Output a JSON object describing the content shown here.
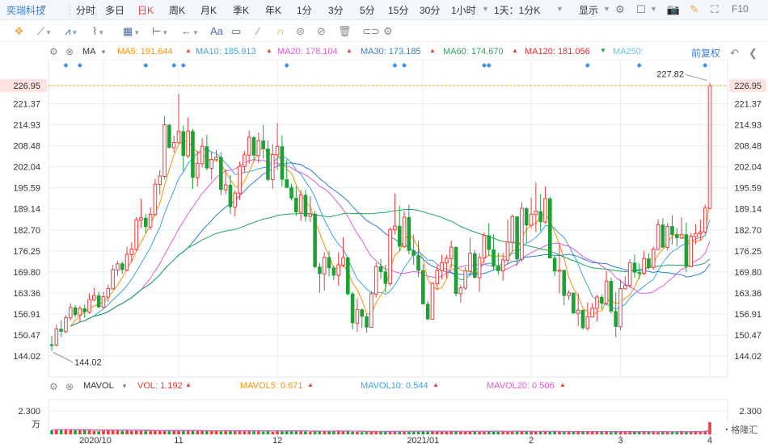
{
  "topbar": {
    "stock_name": "奕瑞科技",
    "periods": [
      "分时",
      "多日",
      "日K",
      "周K",
      "月K",
      "季K",
      "年K",
      "1分",
      "3分",
      "5分",
      "15分",
      "30分",
      "1小时",
      "1天：1分K"
    ],
    "active_period": "日K",
    "display_label": "显示",
    "f10_label": "F10"
  },
  "toolbar": {
    "text_tool": "Aa"
  },
  "ma_legend": {
    "label": "MA",
    "items": [
      {
        "text": "MA5: 191.644",
        "color": "#ff8f00"
      },
      {
        "text": "MA10: 185.913",
        "color": "#3aa3e3"
      },
      {
        "text": "MA20: 178.104",
        "color": "#e05ad6"
      },
      {
        "text": "MA30: 173.185",
        "color": "#2d7fd4"
      },
      {
        "text": "MA60: 174.670",
        "color": "#22a85b"
      },
      {
        "text": "MA120: 181.056",
        "color": "#e0312f"
      },
      {
        "text": "MA250:",
        "color": "#59c7e8"
      }
    ],
    "adjust_label": "前复权"
  },
  "vol_legend": {
    "label": "MAVOL",
    "items": [
      {
        "text": "VOL: 1.192",
        "color": "#ef3b3b"
      },
      {
        "text": "MAVOL5: 0.671",
        "color": "#ff8f00"
      },
      {
        "text": "MAVOL10: 0.544",
        "color": "#3aa3e3"
      },
      {
        "text": "MAVOL20: 0.506",
        "color": "#e05ad6"
      }
    ]
  },
  "colors": {
    "up": "#ef3b3b",
    "down": "#1aa334",
    "grid": "#e6edf7",
    "axis_text": "#333333",
    "price_line": "#f5a623"
  },
  "chart_data": [
    {
      "type": "candlestick",
      "title": "",
      "ylim": [
        140,
        230
      ],
      "y_ticks": [
        "226.95",
        "221.37",
        "214.93",
        "208.48",
        "202.04",
        "195.59",
        "189.14",
        "182.70",
        "176.25",
        "169.80",
        "163.36",
        "156.91",
        "150.47",
        "144.02"
      ],
      "x_ticks": [
        "2020/10",
        "11",
        "12",
        "2021/01",
        "2",
        "3",
        "4"
      ],
      "current_price": "226.95",
      "annotations": {
        "high": "227.82",
        "low": "144.02"
      },
      "candles": [
        [
          147.5,
          150.2,
          145.6,
          147.3
        ],
        [
          147.4,
          153.6,
          147.0,
          152.3
        ],
        [
          152.2,
          155.0,
          149.8,
          151.6
        ],
        [
          151.5,
          156.5,
          151.0,
          155.8
        ],
        [
          155.7,
          160.2,
          154.9,
          158.9
        ],
        [
          158.8,
          159.6,
          155.8,
          156.7
        ],
        [
          156.6,
          159.4,
          154.3,
          158.6
        ],
        [
          158.5,
          159.8,
          155.7,
          157.6
        ],
        [
          157.5,
          163.2,
          157.0,
          161.4
        ],
        [
          161.3,
          164.9,
          160.7,
          162.6
        ],
        [
          162.5,
          163.8,
          158.7,
          159.1
        ],
        [
          159.0,
          163.7,
          158.6,
          162.2
        ],
        [
          162.1,
          165.9,
          160.6,
          164.7
        ],
        [
          164.6,
          171.9,
          164.4,
          170.5
        ],
        [
          170.4,
          173.3,
          168.6,
          172.3
        ],
        [
          172.3,
          173.0,
          169.2,
          170.5
        ],
        [
          170.4,
          177.5,
          170.0,
          175.2
        ],
        [
          175.1,
          178.9,
          172.7,
          176.8
        ],
        [
          176.7,
          186.6,
          176.3,
          185.8
        ],
        [
          185.7,
          192.2,
          183.3,
          186.4
        ],
        [
          186.3,
          187.6,
          181.6,
          183.7
        ],
        [
          183.6,
          189.6,
          182.7,
          187.5
        ],
        [
          187.4,
          198.4,
          186.9,
          196.7
        ],
        [
          196.6,
          201.1,
          193.5,
          199.2
        ],
        [
          199.1,
          217.7,
          198.2,
          214.9
        ],
        [
          214.8,
          215.2,
          207.6,
          208.0
        ],
        [
          207.9,
          211.6,
          206.4,
          209.5
        ],
        [
          209.4,
          224.5,
          209.2,
          212.9
        ],
        [
          212.8,
          214.7,
          200.6,
          205.5
        ],
        [
          205.4,
          217.1,
          204.8,
          213.0
        ],
        [
          212.9,
          213.7,
          195.3,
          198.8
        ],
        [
          198.7,
          206.9,
          196.0,
          203.1
        ],
        [
          203.0,
          210.8,
          201.8,
          208.3
        ],
        [
          208.2,
          211.9,
          200.9,
          201.7
        ],
        [
          201.6,
          206.8,
          198.1,
          204.3
        ],
        [
          204.2,
          207.2,
          203.6,
          205.0
        ],
        [
          204.9,
          206.5,
          193.4,
          195.1
        ],
        [
          195.0,
          201.2,
          193.6,
          196.5
        ],
        [
          196.4,
          199.6,
          187.6,
          189.8
        ],
        [
          189.7,
          194.8,
          186.8,
          194.0
        ],
        [
          193.9,
          203.7,
          191.8,
          202.2
        ],
        [
          202.1,
          206.9,
          200.3,
          205.7
        ],
        [
          205.6,
          213.1,
          202.9,
          211.1
        ],
        [
          211.0,
          211.5,
          203.9,
          205.6
        ],
        [
          205.5,
          212.6,
          203.2,
          210.1
        ],
        [
          210.0,
          214.9,
          204.6,
          207.6
        ],
        [
          207.5,
          210.1,
          197.6,
          198.2
        ],
        [
          198.1,
          209.0,
          195.3,
          205.8
        ],
        [
          205.7,
          215.4,
          201.1,
          208.3
        ],
        [
          208.2,
          211.7,
          195.9,
          198.2
        ],
        [
          198.1,
          204.2,
          195.6,
          195.7
        ],
        [
          195.6,
          196.8,
          191.7,
          192.5
        ],
        [
          192.4,
          196.1,
          187.0,
          188.2
        ],
        [
          188.1,
          194.9,
          185.4,
          193.4
        ],
        [
          193.3,
          195.0,
          185.3,
          186.9
        ],
        [
          186.8,
          193.1,
          185.1,
          187.6
        ],
        [
          187.5,
          188.5,
          170.9,
          171.4
        ],
        [
          171.3,
          172.6,
          163.4,
          169.3
        ],
        [
          169.2,
          175.8,
          164.1,
          174.3
        ],
        [
          174.2,
          176.2,
          168.5,
          171.1
        ],
        [
          171.0,
          171.7,
          167.3,
          168.8
        ],
        [
          168.7,
          175.8,
          165.6,
          172.0
        ],
        [
          171.9,
          180.5,
          171.2,
          174.2
        ],
        [
          174.1,
          174.5,
          162.6,
          163.1
        ],
        [
          163.0,
          163.7,
          152.2,
          154.2
        ],
        [
          154.1,
          161.7,
          151.4,
          158.3
        ],
        [
          158.2,
          158.6,
          152.6,
          156.2
        ],
        [
          156.1,
          157.0,
          151.2,
          152.9
        ],
        [
          152.8,
          163.9,
          152.7,
          163.1
        ],
        [
          163.0,
          172.7,
          161.9,
          171.5
        ],
        [
          171.4,
          173.8,
          167.6,
          169.9
        ],
        [
          169.8,
          172.0,
          163.5,
          166.3
        ],
        [
          166.2,
          183.5,
          165.5,
          182.8
        ],
        [
          182.7,
          193.9,
          181.3,
          183.9
        ],
        [
          183.8,
          190.1,
          176.2,
          177.7
        ],
        [
          177.6,
          188.5,
          177.0,
          186.6
        ],
        [
          186.5,
          190.4,
          175.2,
          176.4
        ],
        [
          176.3,
          181.3,
          172.0,
          174.9
        ],
        [
          174.8,
          179.3,
          168.2,
          170.3
        ],
        [
          170.2,
          172.1,
          159.8,
          160.0
        ],
        [
          159.9,
          160.9,
          155.0,
          155.4
        ],
        [
          155.3,
          166.7,
          155.2,
          166.3
        ],
        [
          166.2,
          171.9,
          164.3,
          170.3
        ],
        [
          170.2,
          175.1,
          167.5,
          172.7
        ],
        [
          172.6,
          175.1,
          167.8,
          174.0
        ],
        [
          173.9,
          179.4,
          171.1,
          177.4
        ],
        [
          177.3,
          177.7,
          162.3,
          163.2
        ],
        [
          163.1,
          165.9,
          160.4,
          164.9
        ],
        [
          164.8,
          171.3,
          164.3,
          170.1
        ],
        [
          170.0,
          180.3,
          168.6,
          175.5
        ],
        [
          175.4,
          176.5,
          167.9,
          168.1
        ],
        [
          168.0,
          175.5,
          163.6,
          174.2
        ],
        [
          174.1,
          181.9,
          172.5,
          181.0
        ],
        [
          180.9,
          184.7,
          174.6,
          176.7
        ],
        [
          176.6,
          181.3,
          170.4,
          171.7
        ],
        [
          171.6,
          175.7,
          168.9,
          170.2
        ],
        [
          170.1,
          175.6,
          167.1,
          173.5
        ],
        [
          173.4,
          185.9,
          172.1,
          179.0
        ],
        [
          178.9,
          187.4,
          176.1,
          186.8
        ],
        [
          186.7,
          186.8,
          171.6,
          173.8
        ],
        [
          173.7,
          191.2,
          172.9,
          189.3
        ],
        [
          189.2,
          189.7,
          178.6,
          184.2
        ],
        [
          184.1,
          192.6,
          183.3,
          187.5
        ],
        [
          187.4,
          197.2,
          182.1,
          188.4
        ],
        [
          188.3,
          193.6,
          182.3,
          185.2
        ],
        [
          185.1,
          196.0,
          184.6,
          192.3
        ],
        [
          192.2,
          192.8,
          173.9,
          174.1
        ],
        [
          174.0,
          175.0,
          168.6,
          170.1
        ],
        [
          170.0,
          178.3,
          163.2,
          170.4
        ],
        [
          170.3,
          170.4,
          159.6,
          162.6
        ],
        [
          162.5,
          164.2,
          161.2,
          163.4
        ],
        [
          163.3,
          163.5,
          157.1,
          157.2
        ],
        [
          157.1,
          163.2,
          153.2,
          158.1
        ],
        [
          158.0,
          158.4,
          152.1,
          152.7
        ],
        [
          152.6,
          160.5,
          151.7,
          156.1
        ],
        [
          156.0,
          160.3,
          155.9,
          158.7
        ],
        [
          158.6,
          162.8,
          154.6,
          162.1
        ],
        [
          162.0,
          162.9,
          158.4,
          160.3
        ],
        [
          160.2,
          170.2,
          159.5,
          167.0
        ],
        [
          166.9,
          168.1,
          157.0,
          157.8
        ],
        [
          157.7,
          163.6,
          149.8,
          153.1
        ],
        [
          153.0,
          167.5,
          151.9,
          164.7
        ],
        [
          164.6,
          168.5,
          164.4,
          165.7
        ],
        [
          165.6,
          173.7,
          165.0,
          172.6
        ],
        [
          172.5,
          175.2,
          168.1,
          169.7
        ],
        [
          169.6,
          172.4,
          167.6,
          169.5
        ],
        [
          169.4,
          176.3,
          168.8,
          173.9
        ],
        [
          173.8,
          175.5,
          170.6,
          171.2
        ],
        [
          171.1,
          177.5,
          170.5,
          176.8
        ],
        [
          176.7,
          186.0,
          176.6,
          184.3
        ],
        [
          184.2,
          186.3,
          177.2,
          177.4
        ],
        [
          177.3,
          184.8,
          176.4,
          183.8
        ],
        [
          183.7,
          187.2,
          178.2,
          181.3
        ],
        [
          181.2,
          183.3,
          177.6,
          180.3
        ],
        [
          180.2,
          186.6,
          179.9,
          181.3
        ],
        [
          181.2,
          185.0,
          169.7,
          171.5
        ],
        [
          171.4,
          181.7,
          171.3,
          180.7
        ],
        [
          180.6,
          184.5,
          178.3,
          181.6
        ],
        [
          181.5,
          185.8,
          179.5,
          182.1
        ],
        [
          182.0,
          190.5,
          181.5,
          189.4
        ],
        [
          189.3,
          227.8,
          189.1,
          226.9
        ]
      ]
    },
    {
      "type": "bar",
      "title": "MAVOL",
      "y_tick": "2.300",
      "unit": "万",
      "ylim": [
        0,
        2.3
      ],
      "values": [
        0.406,
        0.505,
        0.505,
        0.478,
        0.455,
        0.395,
        0.45,
        0.438,
        0.418,
        0.337,
        0.3,
        0.457,
        0.461,
        0.411,
        0.478,
        0.341,
        0.405,
        0.342,
        0.408,
        0.318,
        0.315,
        0.311,
        0.347,
        0.412,
        0.398,
        0.367,
        0.39,
        0.424,
        0.394,
        0.394,
        0.329,
        0.325,
        0.325,
        0.319,
        0.313,
        0.38,
        0.268,
        0.414,
        0.385,
        0.336,
        0.381,
        0.297,
        0.375,
        0.299,
        0.367,
        0.257,
        0.389,
        0.233,
        0.376,
        0.31,
        0.378,
        0.367,
        0.275,
        0.309,
        0.287,
        0.25,
        0.302,
        0.351,
        0.347,
        0.34,
        0.301,
        0.348,
        0.337,
        0.337,
        0.258,
        0.247,
        0.22,
        0.227,
        0.232,
        0.267,
        0.323,
        0.282,
        0.289,
        0.336,
        0.259,
        0.328,
        0.283,
        0.339,
        0.327,
        0.307,
        0.322,
        0.31,
        0.304,
        0.313,
        0.248,
        0.312,
        0.301,
        0.246,
        0.321,
        0.296,
        0.267,
        0.309,
        0.311,
        0.307,
        0.256,
        0.317,
        0.311,
        0.24,
        0.326,
        0.322,
        0.297,
        0.249,
        0.276,
        0.247,
        0.308,
        0.307,
        0.27,
        0.276,
        0.254,
        0.225,
        0.301,
        0.292,
        0.239,
        0.269,
        0.294,
        0.297,
        0.256,
        0.257,
        0.27,
        0.213,
        0.274,
        0.29,
        0.211,
        0.286,
        0.29,
        0.231,
        0.273,
        0.277,
        0.265,
        0.219,
        0.274,
        0.258,
        0.217,
        0.278,
        0.323,
        0.225,
        0.305,
        0.296,
        0.268,
        0.344,
        1.192
      ]
    }
  ]
}
